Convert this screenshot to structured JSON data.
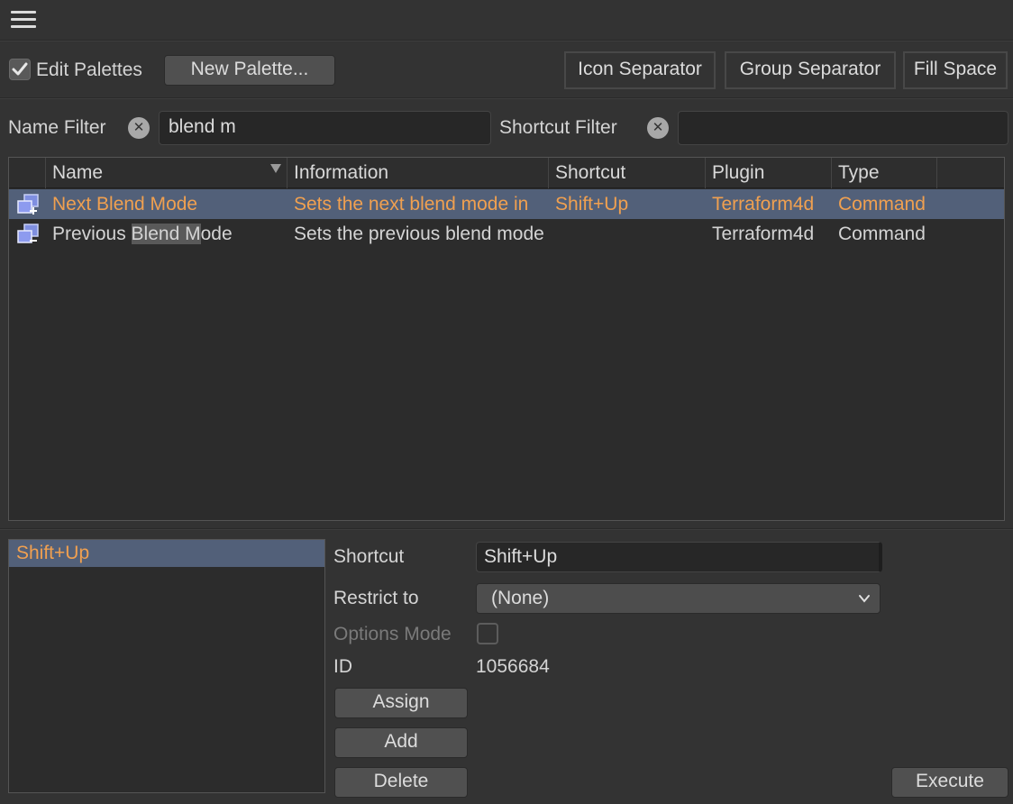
{
  "toolbar": {
    "edit_palettes_label": "Edit Palettes",
    "new_palette_label": "New Palette...",
    "icon_separator_label": "Icon Separator",
    "group_separator_label": "Group Separator",
    "fill_space_label": "Fill Space"
  },
  "filters": {
    "name_label": "Name Filter",
    "name_value": "blend m",
    "shortcut_label": "Shortcut Filter",
    "shortcut_value": ""
  },
  "table": {
    "columns": [
      "Name",
      "Information",
      "Shortcut",
      "Plugin",
      "Type"
    ],
    "rows": [
      {
        "name_pre": "Next ",
        "name_hl": "Blend M",
        "name_post": "ode",
        "information": "Sets the next blend mode in",
        "shortcut": "Shift+Up",
        "plugin": "Terraform4d",
        "type": "Command",
        "selected": true
      },
      {
        "name_pre": "Previous ",
        "name_hl": "Blend M",
        "name_post": "ode",
        "information": "Sets the previous blend mode",
        "shortcut": "",
        "plugin": "Terraform4d",
        "type": "Command",
        "selected": false
      }
    ]
  },
  "details": {
    "shortcut_list": [
      "Shift+Up"
    ],
    "shortcut_label": "Shortcut",
    "shortcut_value": "Shift+Up",
    "restrict_label": "Restrict to",
    "restrict_value": "(None)",
    "options_mode_label": "Options Mode",
    "id_label": "ID",
    "id_value": "1056684",
    "assign_label": "Assign",
    "add_label": "Add",
    "delete_label": "Delete",
    "execute_label": "Execute"
  },
  "colors": {
    "background": "#333333",
    "selected_row": "#526079",
    "selected_text": "#f0a050"
  }
}
